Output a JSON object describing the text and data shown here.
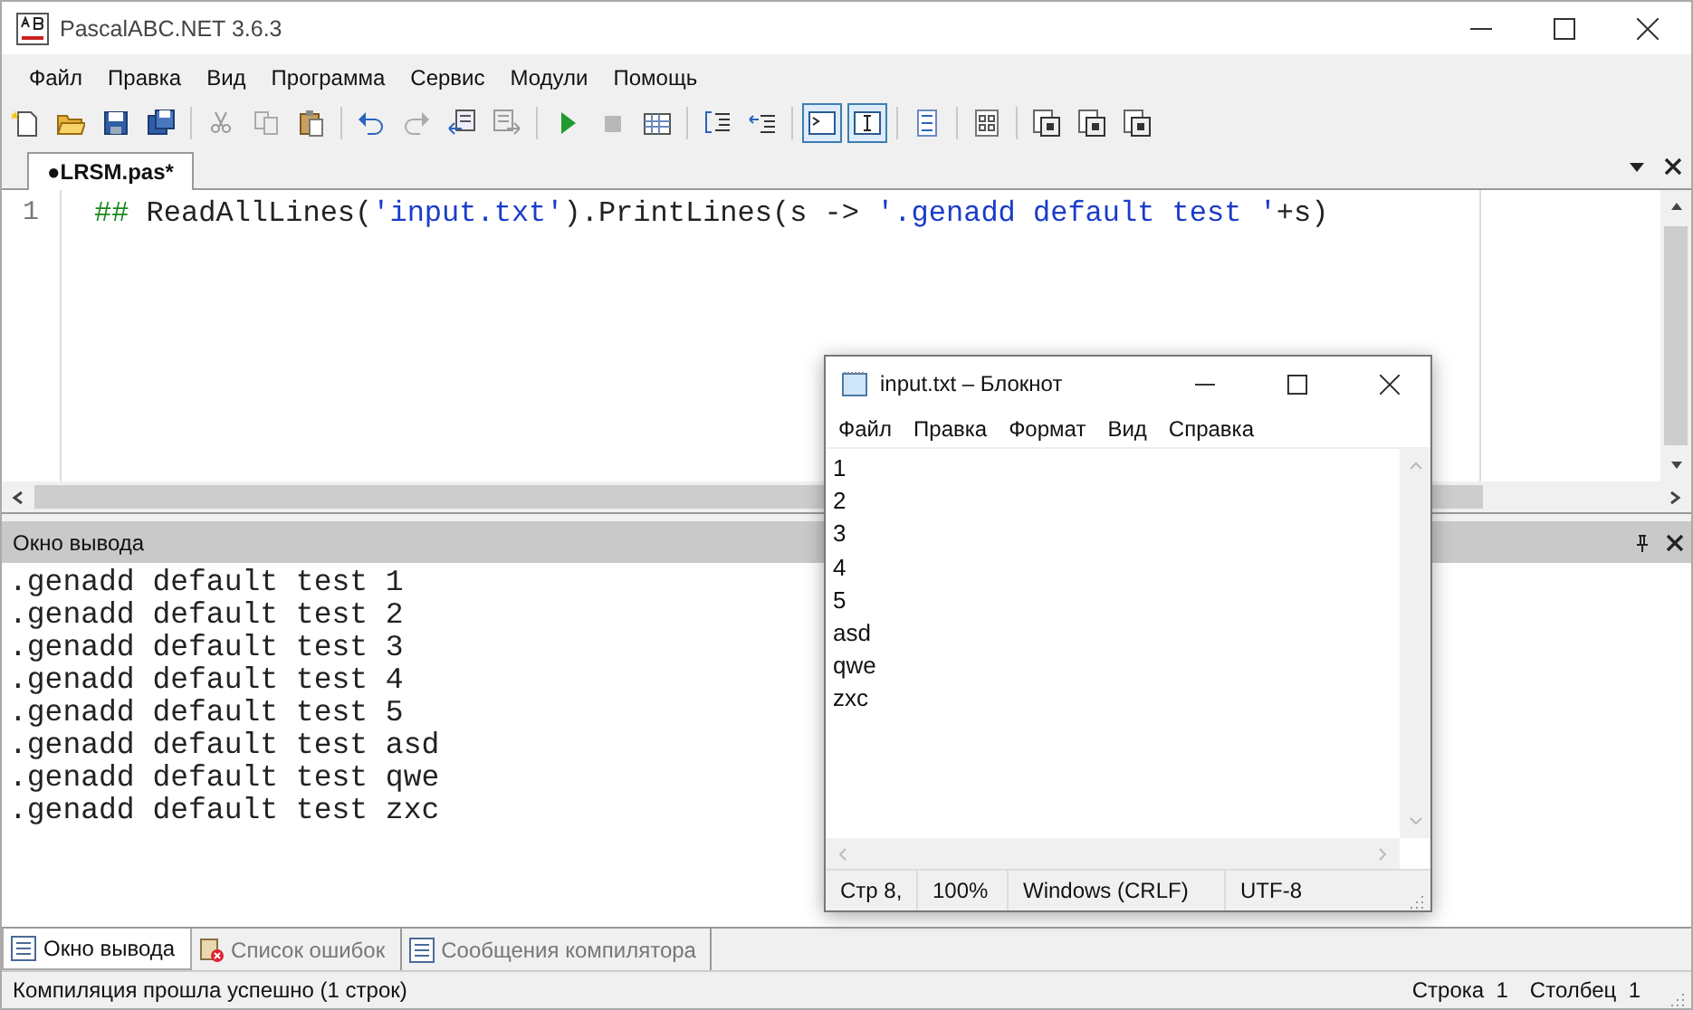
{
  "window": {
    "title": "PascalABC.NET 3.6.3"
  },
  "menu": [
    "Файл",
    "Правка",
    "Вид",
    "Программа",
    "Сервис",
    "Модули",
    "Помощь"
  ],
  "toolbar": [
    [
      {
        "kind": "page"
      },
      {
        "kind": "folder"
      },
      {
        "kind": "floppy-disk"
      },
      {
        "kind": "floppy-disks"
      }
    ],
    [
      {
        "kind": "scissors"
      },
      {
        "kind": "copy"
      },
      {
        "kind": "clipboard"
      }
    ],
    [
      {
        "kind": "undo"
      },
      {
        "kind": "redo"
      },
      {
        "kind": "page-arrow-left"
      },
      {
        "kind": "page-arrow-right"
      }
    ],
    [
      {
        "kind": "play"
      },
      {
        "kind": "stop"
      },
      {
        "kind": "grid"
      }
    ],
    [
      {
        "kind": "list-arrow"
      },
      {
        "kind": "list-arrow-back"
      }
    ],
    [
      {
        "kind": "console",
        "on": true
      },
      {
        "kind": "text-cursor",
        "on": true
      }
    ],
    [
      {
        "kind": "panel"
      }
    ],
    [
      {
        "kind": "code-page"
      }
    ],
    [
      {
        "kind": "page-stack"
      },
      {
        "kind": "page-stack"
      },
      {
        "kind": "page-stack"
      }
    ]
  ],
  "editor_tabs": [
    {
      "label": "●LRSM.pas*",
      "selected": true
    }
  ],
  "editor": {
    "lines": [
      {
        "number": "1",
        "segments": [
          {
            "kind": "operator",
            "text": "##"
          },
          {
            "kind": "plain",
            "text": " ReadAllLines("
          },
          {
            "kind": "string",
            "text": "'input.txt'"
          },
          {
            "kind": "plain",
            "text": ").PrintLines(s -> "
          },
          {
            "kind": "string",
            "text": "'.genadd default test '"
          },
          {
            "kind": "plain",
            "text": "+s)"
          }
        ]
      }
    ]
  },
  "output_panel": {
    "title": "Окно вывода",
    "lines": [
      ".genadd default test 1",
      ".genadd default test 2",
      ".genadd default test 3",
      ".genadd default test 4",
      ".genadd default test 5",
      ".genadd default test asd",
      ".genadd default test qwe",
      ".genadd default test zxc"
    ]
  },
  "bottom_tabs": [
    {
      "label": "Окно вывода",
      "kind": "list",
      "selected": true
    },
    {
      "label": "Список ошибок",
      "kind": "error",
      "selected": false
    },
    {
      "label": "Сообщения компилятора",
      "kind": "list",
      "selected": false
    }
  ],
  "status_bar": {
    "message": "Компиляция прошла успешно (1 строк)",
    "line": "Строка  1",
    "column": "Столбец  1"
  },
  "notepad": {
    "title": "input.txt – Блокнот",
    "menu": [
      "Файл",
      "Правка",
      "Формат",
      "Вид",
      "Справка"
    ],
    "lines": [
      "1",
      "2",
      "3",
      "4",
      "5",
      "asd",
      "qwe",
      "zxc"
    ],
    "status": [
      "Стр 8,",
      "100%",
      "Windows (CRLF)",
      "UTF-8"
    ]
  }
}
